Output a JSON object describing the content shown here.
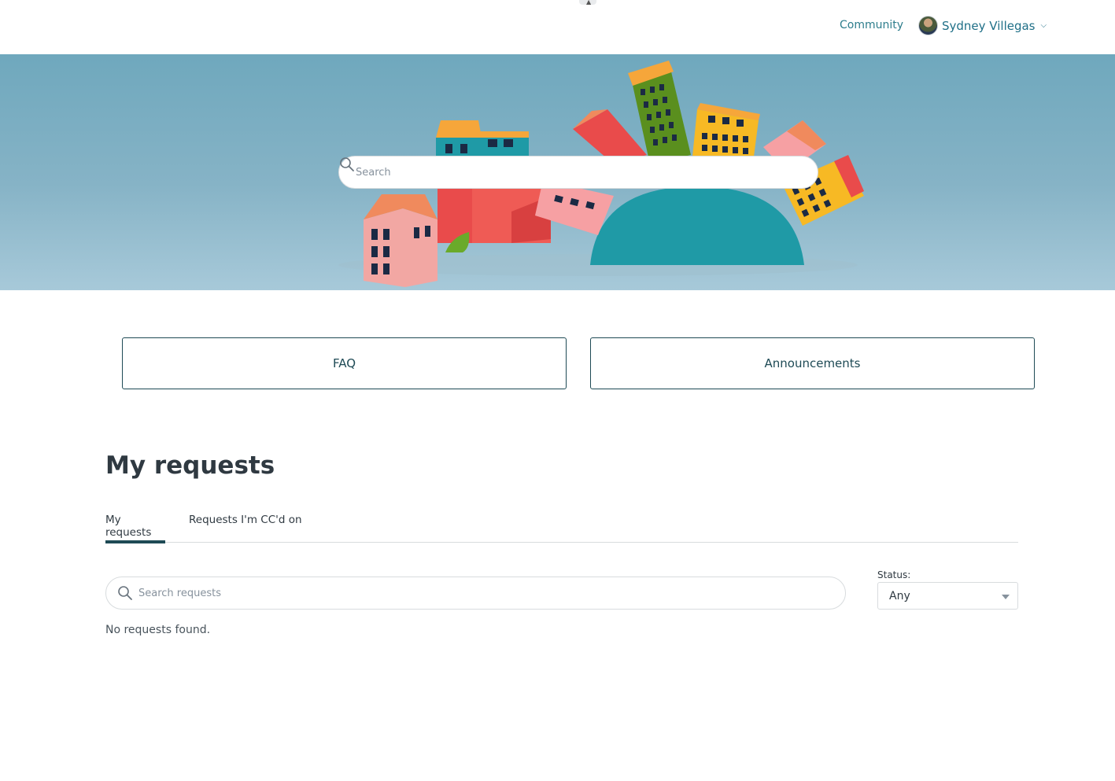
{
  "header": {
    "community_label": "Community",
    "user_name": "Sydney Villegas",
    "dropdown_icon": "chevron-down-icon"
  },
  "hero": {
    "search_placeholder": "Search",
    "search_icon": "search-icon"
  },
  "categories": [
    {
      "label": "FAQ"
    },
    {
      "label": "Announcements"
    }
  ],
  "requests": {
    "title": "My requests",
    "tabs": [
      {
        "label": "My requests",
        "active": true
      },
      {
        "label": "Requests I'm CC'd on",
        "active": false
      }
    ],
    "search_placeholder": "Search requests",
    "status_label": "Status:",
    "status_value": "Any",
    "empty_message": "No requests found."
  },
  "colors": {
    "brand_dark": "#1e4a55",
    "link": "#1f6f87",
    "hero_sky": "#86b3c6"
  }
}
